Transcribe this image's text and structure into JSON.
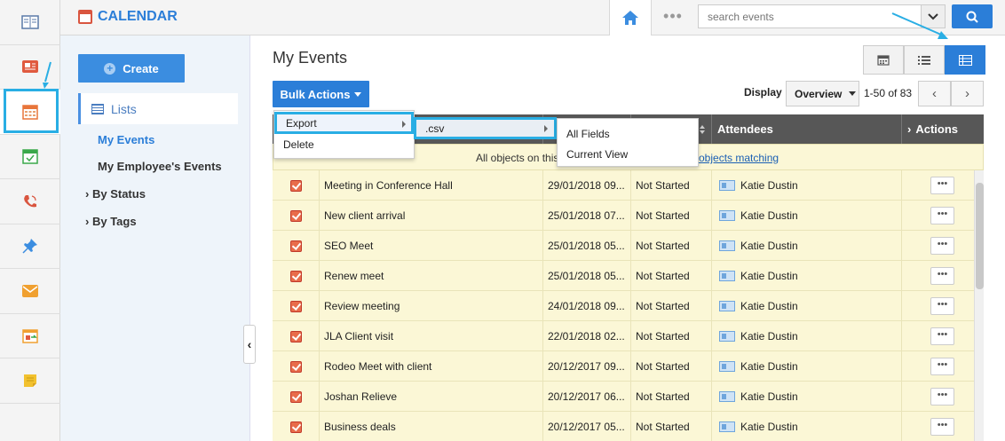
{
  "header": {
    "app_title": "CALENDAR",
    "search_placeholder": "search events",
    "more_label": "•••"
  },
  "rail": {
    "items": [
      {
        "icon": "contacts-icon",
        "color": "#5a7aa8"
      },
      {
        "icon": "news-icon",
        "color": "#e05a3f"
      },
      {
        "icon": "calendar-icon",
        "color": "#e8753a"
      },
      {
        "icon": "tasks-icon",
        "color": "#3aa84a"
      },
      {
        "icon": "phone-icon",
        "color": "#d9553f"
      },
      {
        "icon": "pin-icon",
        "color": "#3b8de0"
      },
      {
        "icon": "mail-icon",
        "color": "#f0a030"
      },
      {
        "icon": "deals-icon",
        "color": "#f0a030"
      },
      {
        "icon": "notes-icon",
        "color": "#f2c12e"
      }
    ]
  },
  "sidebar": {
    "create_label": "Create",
    "lists_label": "Lists",
    "links": [
      {
        "label": "My Events"
      },
      {
        "label": "My Employee's Events"
      },
      {
        "label": "By Status"
      },
      {
        "label": "By Tags"
      }
    ]
  },
  "main": {
    "title": "My Events",
    "bulk_label": "Bulk Actions",
    "display_label": "Display",
    "display_value": "Overview",
    "page_count": "1-50 of 83",
    "columns": {
      "attendees": "Attendees",
      "actions": "Actions"
    },
    "banner_text": "All objects on this",
    "banner_link": "objects matching",
    "rows": [
      {
        "subject": "Meeting in Conference Hall",
        "date": "29/01/2018 09...",
        "status": "Not Started",
        "attendee": "Katie Dustin"
      },
      {
        "subject": "New client arrival",
        "date": "25/01/2018 07...",
        "status": "Not Started",
        "attendee": "Katie Dustin"
      },
      {
        "subject": "SEO Meet",
        "date": "25/01/2018 05...",
        "status": "Not Started",
        "attendee": "Katie Dustin"
      },
      {
        "subject": "Renew meet",
        "date": "25/01/2018 05...",
        "status": "Not Started",
        "attendee": "Katie Dustin"
      },
      {
        "subject": "Review meeting",
        "date": "24/01/2018 09...",
        "status": "Not Started",
        "attendee": "Katie Dustin"
      },
      {
        "subject": "JLA Client visit",
        "date": "22/01/2018 02...",
        "status": "Not Started",
        "attendee": "Katie Dustin"
      },
      {
        "subject": "Rodeo Meet with client",
        "date": "20/12/2017 09...",
        "status": "Not Started",
        "attendee": "Katie Dustin"
      },
      {
        "subject": "Joshan Relieve",
        "date": "20/12/2017 06...",
        "status": "Not Started",
        "attendee": "Katie Dustin"
      },
      {
        "subject": "Business deals",
        "date": "20/12/2017 05...",
        "status": "Not Started",
        "attendee": "Katie Dustin"
      }
    ],
    "row_more_label": "•••"
  },
  "bulk_menu": {
    "items": [
      {
        "label": "Export"
      },
      {
        "label": "Delete"
      }
    ],
    "export_sub": ".csv",
    "csv_sub": [
      {
        "label": "All Fields"
      },
      {
        "label": "Current View"
      }
    ]
  },
  "colors": {
    "accent": "#2b7ed8",
    "highlight": "#29aee4",
    "row_bg": "#fbf7d6",
    "header_bg": "#575757"
  }
}
